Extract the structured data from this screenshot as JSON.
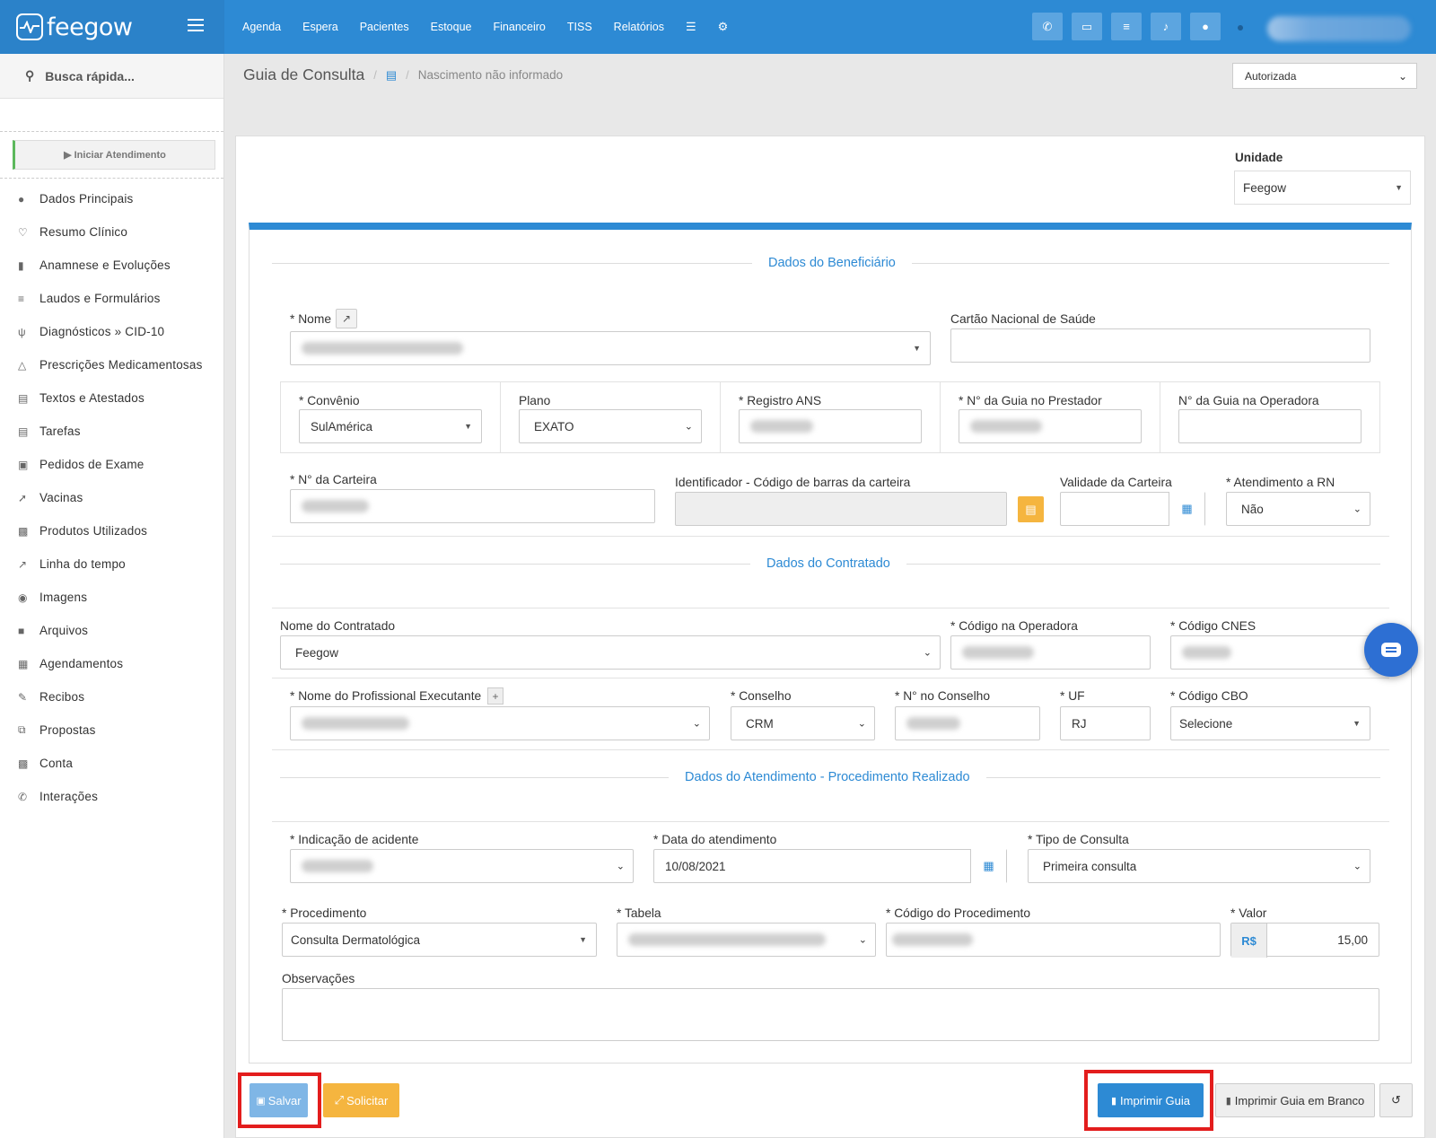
{
  "app": {
    "name": "feegow"
  },
  "topnav": {
    "items": [
      "Agenda",
      "Espera",
      "Pacientes",
      "Estoque",
      "Financeiro",
      "TISS",
      "Relatórios"
    ],
    "icons": [
      "database-icon",
      "gear-icon"
    ],
    "right_icons": [
      "phone-icon",
      "inbox-icon",
      "list-icon",
      "bell-icon",
      "chat-icon"
    ]
  },
  "sidebar": {
    "search_placeholder": "Busca rápida...",
    "start_button": "▶ Iniciar Atendimento",
    "items": [
      {
        "label": "Dados Principais",
        "icon": "user-icon"
      },
      {
        "label": "Resumo Clínico",
        "icon": "heart-icon"
      },
      {
        "label": "Anamnese e Evoluções",
        "icon": "bar-chart-icon"
      },
      {
        "label": "Laudos e Formulários",
        "icon": "list-icon"
      },
      {
        "label": "Diagnósticos » CID-10",
        "icon": "stethoscope-icon"
      },
      {
        "label": "Prescrições Medicamentosas",
        "icon": "flask-icon"
      },
      {
        "label": "Textos e Atestados",
        "icon": "document-icon"
      },
      {
        "label": "Tarefas",
        "icon": "document-icon"
      },
      {
        "label": "Pedidos de Exame",
        "icon": "clipboard-icon"
      },
      {
        "label": "Vacinas",
        "icon": "pin-icon"
      },
      {
        "label": "Produtos Utilizados",
        "icon": "medkit-icon"
      },
      {
        "label": "Linha do tempo",
        "icon": "line-chart-icon"
      },
      {
        "label": "Imagens",
        "icon": "camera-icon"
      },
      {
        "label": "Arquivos",
        "icon": "file-icon"
      },
      {
        "label": "Agendamentos",
        "icon": "calendar-icon"
      },
      {
        "label": "Recibos",
        "icon": "edit-icon"
      },
      {
        "label": "Propostas",
        "icon": "copy-icon"
      },
      {
        "label": "Conta",
        "icon": "money-icon"
      },
      {
        "label": "Interações",
        "icon": "phone-icon"
      }
    ]
  },
  "header": {
    "title": "Guia de Consulta",
    "subtitle": "Nascimento não informado",
    "status_value": "Autorizada"
  },
  "unit": {
    "label": "Unidade",
    "value": "Feegow"
  },
  "sections": {
    "beneficiario": "Dados do Beneficiário",
    "contratado": "Dados do Contratado",
    "atendimento": "Dados do Atendimento - Procedimento Realizado"
  },
  "fields": {
    "nome": {
      "label": "* Nome"
    },
    "cns": {
      "label": "Cartão Nacional de Saúde",
      "value": ""
    },
    "convenio": {
      "label": "* Convênio",
      "value": "SulAmérica"
    },
    "plano": {
      "label": "Plano",
      "value": "EXATO"
    },
    "registro_ans": {
      "label": "* Registro ANS"
    },
    "guia_prestador": {
      "label": "* N° da Guia no Prestador"
    },
    "guia_operadora": {
      "label": "N° da Guia na Operadora",
      "value": ""
    },
    "carteira": {
      "label": "* N° da Carteira"
    },
    "identificador": {
      "label": "Identificador - Código de barras da carteira",
      "value": ""
    },
    "validade": {
      "label": "Validade da Carteira",
      "value": ""
    },
    "atendimento_rn": {
      "label": "* Atendimento a RN",
      "value": "Não"
    },
    "nome_contratado": {
      "label": "Nome do Contratado",
      "value": "Feegow"
    },
    "codigo_operadora": {
      "label": "* Código na Operadora"
    },
    "codigo_cnes": {
      "label": "* Código CNES"
    },
    "profissional": {
      "label": "* Nome do Profissional Executante"
    },
    "conselho": {
      "label": "* Conselho",
      "value": "CRM"
    },
    "numero_conselho": {
      "label": "* N° no Conselho"
    },
    "uf": {
      "label": "* UF",
      "value": "RJ"
    },
    "cbo": {
      "label": "* Código CBO",
      "value": "Selecione"
    },
    "indicacao_acidente": {
      "label": "* Indicação de acidente"
    },
    "data_atendimento": {
      "label": "* Data do atendimento",
      "value": "10/08/2021"
    },
    "tipo_consulta": {
      "label": "* Tipo de Consulta",
      "value": "Primeira consulta"
    },
    "procedimento": {
      "label": "* Procedimento",
      "value": "Consulta Dermatológica"
    },
    "tabela": {
      "label": "* Tabela"
    },
    "codigo_procedimento": {
      "label": "* Código do Procedimento"
    },
    "valor": {
      "label": "* Valor",
      "currency": "R$",
      "value": "15,00"
    },
    "observacoes": {
      "label": "Observações",
      "value": ""
    }
  },
  "actions": {
    "save": "Salvar",
    "request": "Solicitar",
    "print": "Imprimir Guia",
    "print_blank": "Imprimir Guia em Branco"
  },
  "colors": {
    "primary": "#2d8ad4",
    "warning": "#f5b53f",
    "highlight": "#e31d1d",
    "save_button": "#7fb6e6"
  }
}
